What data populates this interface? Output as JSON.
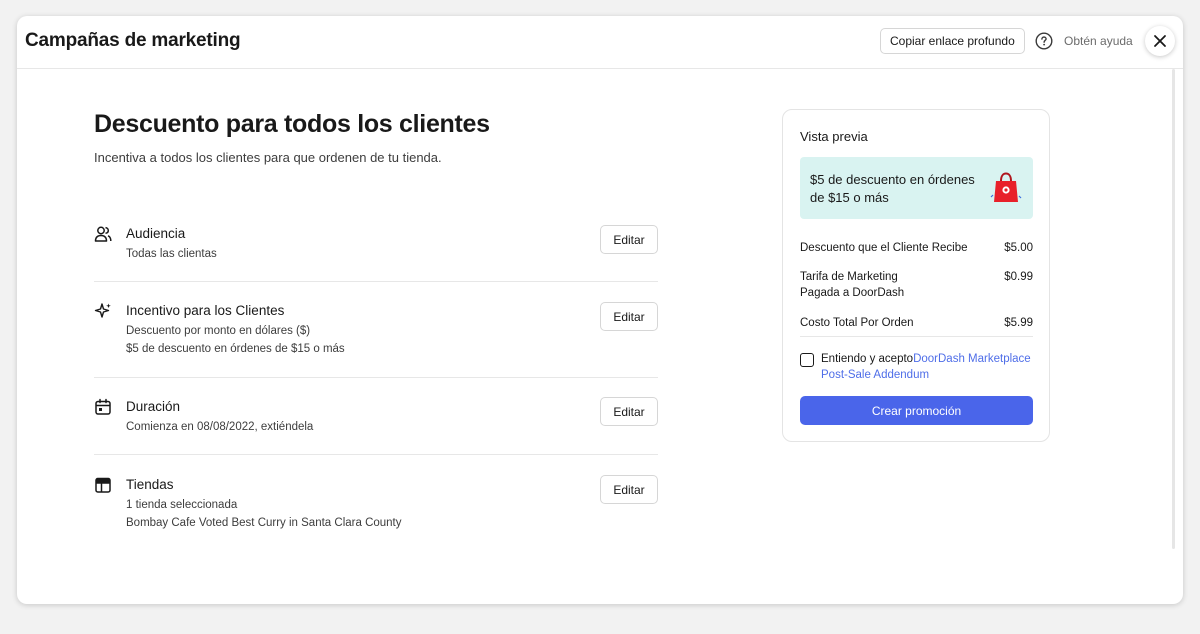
{
  "header": {
    "title": "Campañas de marketing",
    "copy_link_label": "Copiar enlace profundo",
    "help_label": "Obtén ayuda"
  },
  "main": {
    "title": "Descuento para todos los clientes",
    "subtitle": "Incentiva a todos los clientes para que ordenen de tu tienda.",
    "edit_label": "Editar",
    "sections": [
      {
        "icon": "users-icon",
        "title": "Audiencia",
        "lines": [
          "Todas las clientas"
        ]
      },
      {
        "icon": "sparkle-icon",
        "title": "Incentivo para los Clientes",
        "lines": [
          "Descuento por monto en dólares ($)",
          "$5 de descuento en órdenes de $15 o más"
        ]
      },
      {
        "icon": "calendar-icon",
        "title": "Duración",
        "lines": [
          "Comienza en 08/08/2022, extiéndela"
        ]
      },
      {
        "icon": "store-icon",
        "title": "Tiendas",
        "lines": [
          "1 tienda seleccionada",
          "Bombay Cafe Voted Best Curry in Santa Clara County"
        ]
      }
    ]
  },
  "preview": {
    "title": "Vista previa",
    "promo_text": "$5 de descuento en órdenes de $15 o más",
    "promo_icon": "shopping-bag-icon",
    "rows": [
      {
        "label": "Descuento que el Cliente Recibe",
        "value": "$5.00"
      },
      {
        "label": "Tarifa de Marketing Pagada a DoorDash",
        "value": "$0.99"
      },
      {
        "label": "Costo Total Por Orden",
        "value": "$5.99"
      }
    ],
    "agree_text": "Entiendo y acepto",
    "agree_link": "DoorDash Marketplace Post-Sale Addendum",
    "agree_checked": false,
    "create_label": "Crear promoción"
  },
  "colors": {
    "accent": "#4a65ea",
    "link": "#4f6ee8",
    "promo_bg": "#d9f3f1",
    "bag_red": "#e8202a"
  }
}
